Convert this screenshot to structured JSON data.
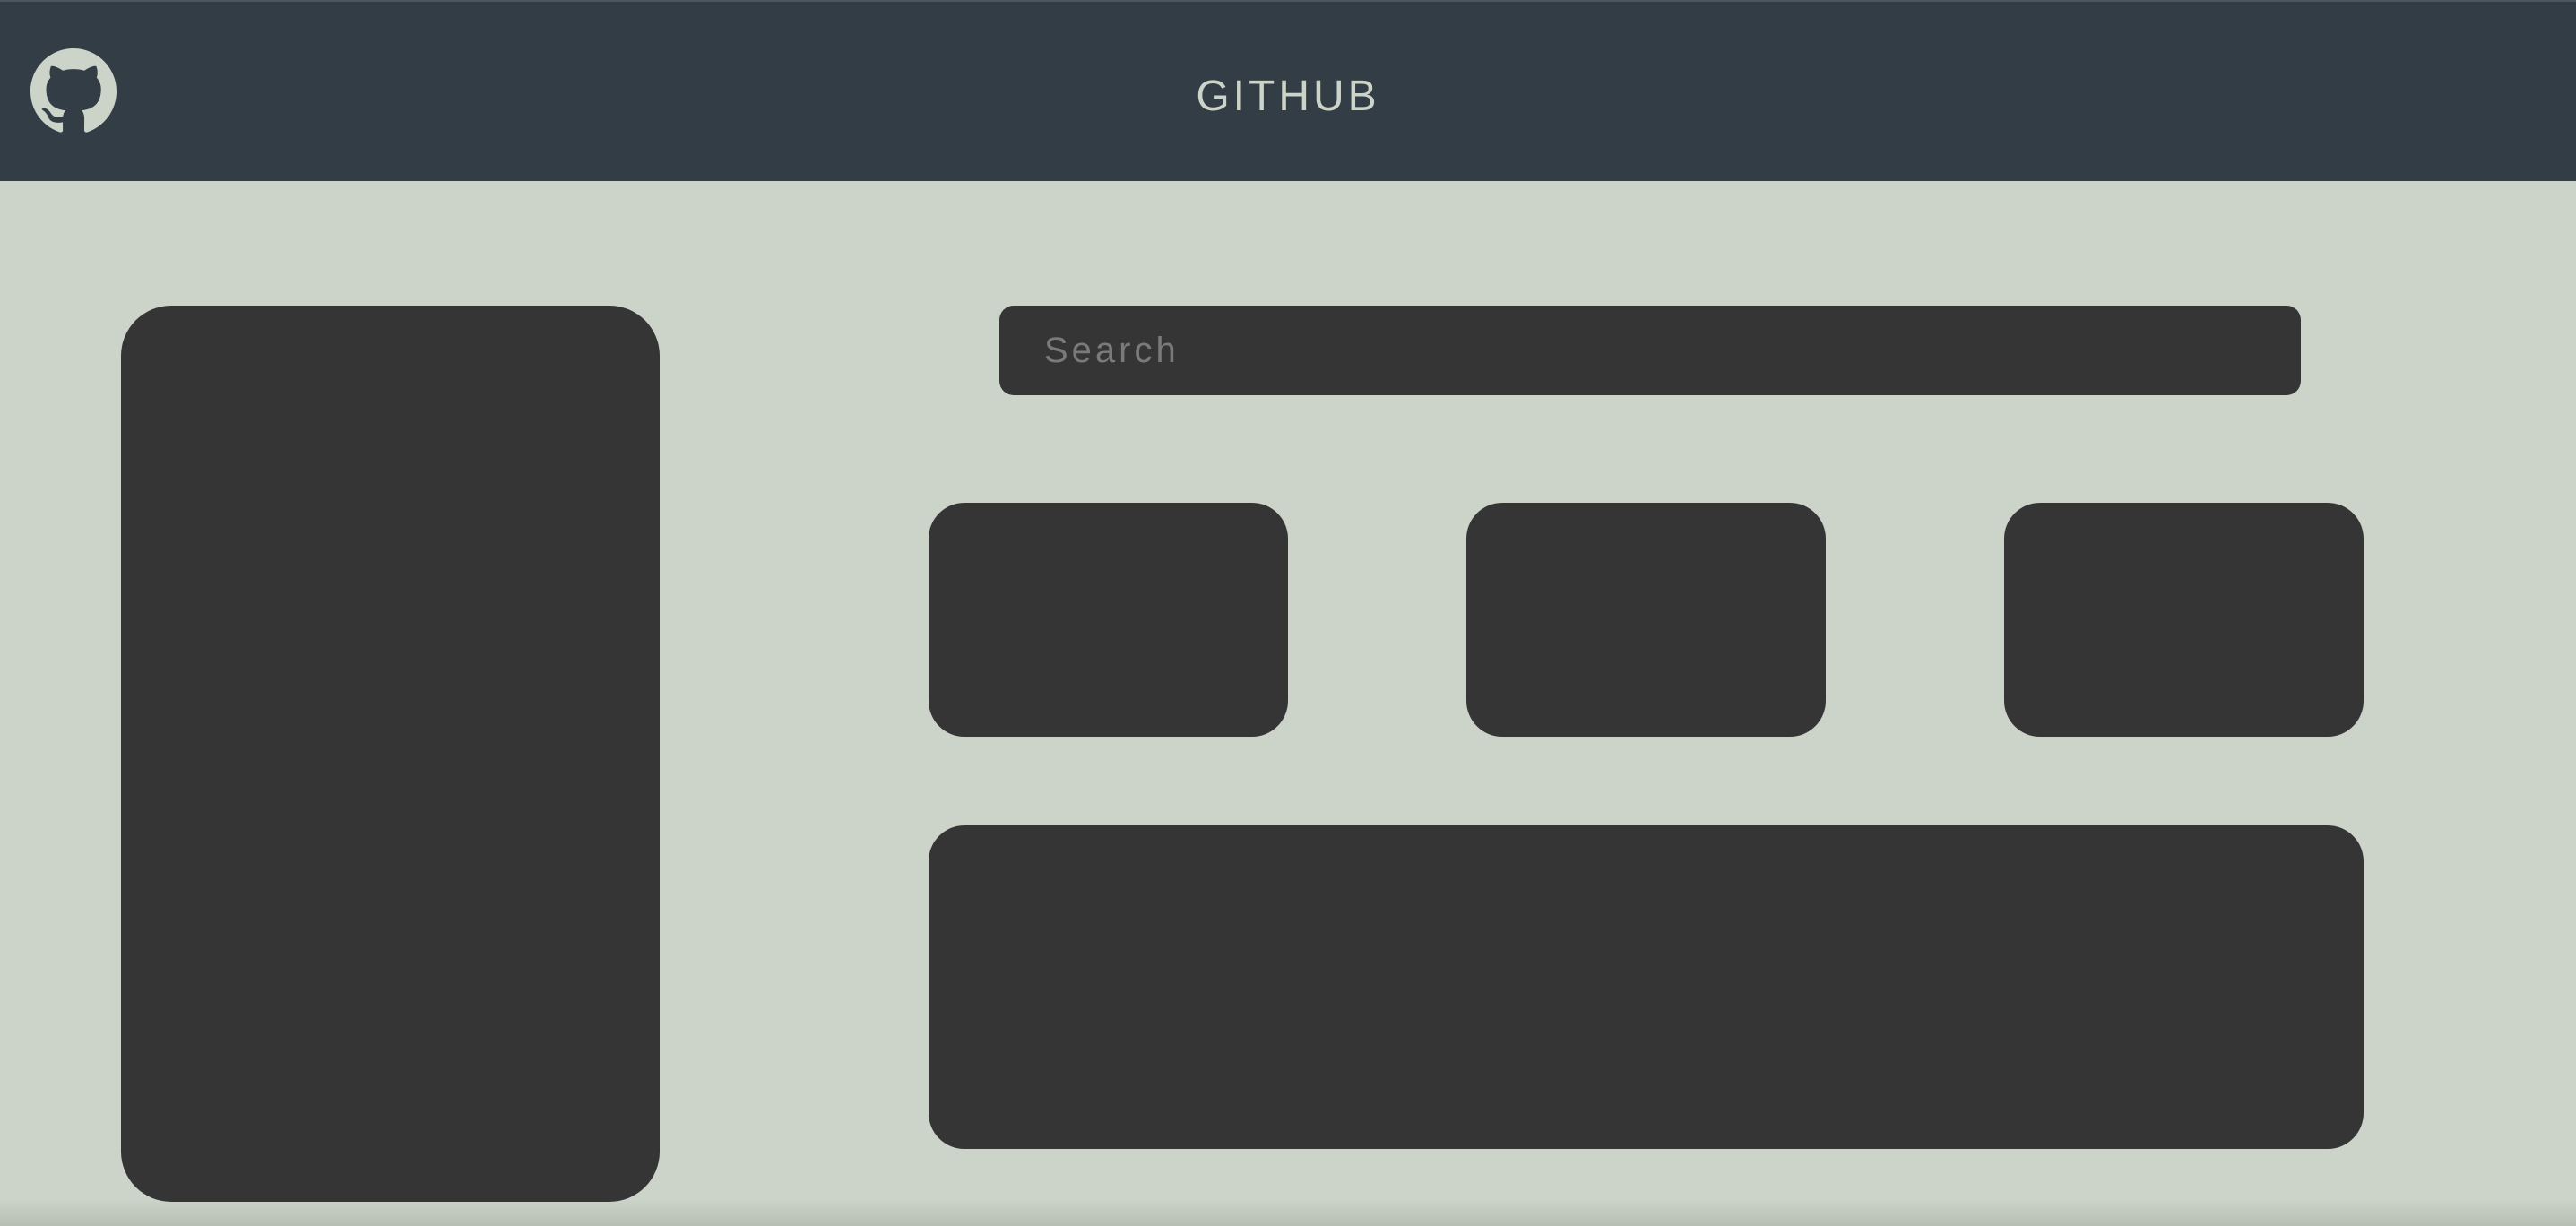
{
  "header": {
    "title": "GITHUB",
    "logo_icon": "github-icon"
  },
  "search": {
    "placeholder": "Search",
    "value": ""
  },
  "colors": {
    "background": "#ccd3c8",
    "header": "#323d46",
    "card": "#353535",
    "header_text": "#ccd3c8",
    "placeholder": "#7a7a7a"
  }
}
